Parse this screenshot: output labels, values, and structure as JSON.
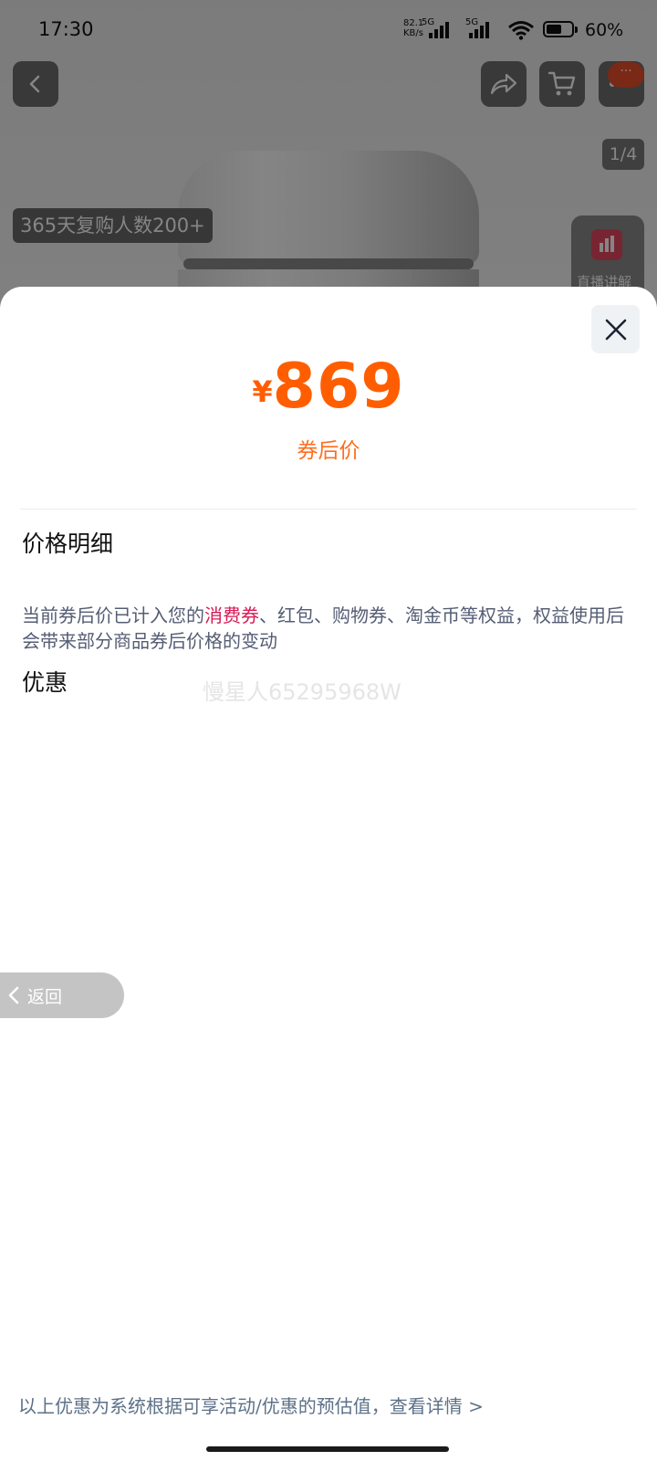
{
  "status_bar": {
    "time": "17:30",
    "net_speed_value": "82.1",
    "net_speed_unit": "KB/s",
    "sim1_label": "5G",
    "sim2_label": "5G",
    "battery_percent": "60%",
    "battery_level": 0.6
  },
  "product_header": {
    "image_counter": "1/4",
    "repurchase_badge": "365天复购人数200+",
    "live_label": "直播讲解",
    "notif_dots": "···"
  },
  "sheet": {
    "price_currency": "¥",
    "price_value": "869",
    "price_caption": "券后价",
    "breakdown_title": "价格明细",
    "note_before": "当前券后价已计入您的",
    "note_highlight": "消费券",
    "note_after": "、红包、购物券、淘金币等权益，权益使用后会带来部分商品券后价格的变动",
    "discount_title": "优惠",
    "watermark": "慢星人65295968W",
    "back_label": "返回",
    "footer_link": "以上优惠为系统根据可享活动/优惠的预估值，查看详情 >"
  },
  "colors": {
    "price_accent": "#ff5e00",
    "highlight": "#d61a55",
    "footer_link": "#5d7188"
  },
  "icons": [
    "back-icon",
    "share-icon",
    "cart-icon",
    "more-icon",
    "close-icon",
    "live-chart-icon",
    "chevron-left-icon"
  ]
}
